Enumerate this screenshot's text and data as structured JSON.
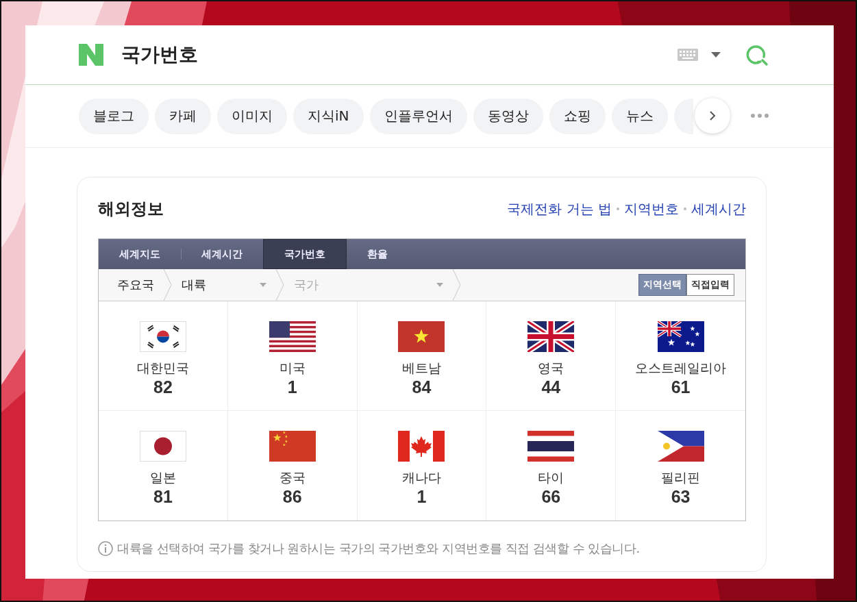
{
  "header": {
    "title": "국가번호"
  },
  "search_tabs": [
    "블로그",
    "카페",
    "이미지",
    "지식iN",
    "인플루언서",
    "동영상",
    "쇼핑",
    "뉴스"
  ],
  "card": {
    "title": "해외정보",
    "links": [
      "국제전화 거는 법",
      "지역번호",
      "세계시간"
    ]
  },
  "widget": {
    "tabs": [
      {
        "label": "세계지도",
        "selected": false
      },
      {
        "label": "세계시간",
        "selected": false
      },
      {
        "label": "국가번호",
        "selected": true
      },
      {
        "label": "환율",
        "selected": false
      }
    ],
    "breadcrumb": [
      {
        "label": "주요국",
        "kind": "plain",
        "disabled": false
      },
      {
        "label": "대륙",
        "kind": "dropdown",
        "disabled": false
      },
      {
        "label": "국가",
        "kind": "dropdown",
        "disabled": true
      }
    ],
    "modes": [
      {
        "label": "지역선택",
        "selected": true
      },
      {
        "label": "직접입력",
        "selected": false
      }
    ],
    "countries": [
      {
        "name": "대한민국",
        "code": "82"
      },
      {
        "name": "미국",
        "code": "1"
      },
      {
        "name": "베트남",
        "code": "84"
      },
      {
        "name": "영국",
        "code": "44"
      },
      {
        "name": "오스트레일리아",
        "code": "61"
      },
      {
        "name": "일본",
        "code": "81"
      },
      {
        "name": "중국",
        "code": "86"
      },
      {
        "name": "캐나다",
        "code": "1"
      },
      {
        "name": "타이",
        "code": "66"
      },
      {
        "name": "필리핀",
        "code": "63"
      }
    ]
  },
  "note": "대륙을 선택하여 국가를 찾거나 원하시는 국가의 국가번호와 지역번호를 직접 검색할 수 있습니다."
}
